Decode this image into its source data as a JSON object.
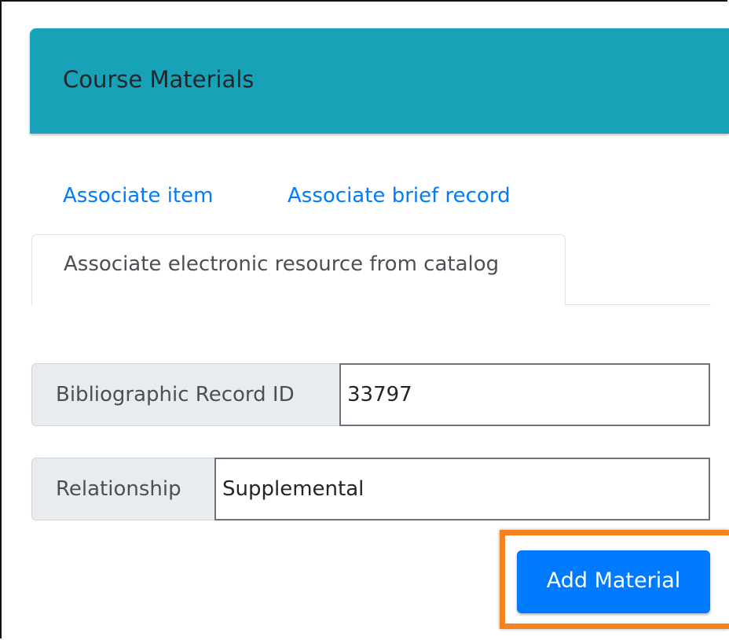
{
  "card": {
    "title": "Course Materials",
    "header_color": "#17a2b8"
  },
  "tabs": [
    {
      "label": "Associate item",
      "active": false
    },
    {
      "label": "Associate brief record",
      "active": false
    },
    {
      "label": "Associate electronic resource from catalog",
      "active": true
    }
  ],
  "form": {
    "bib_id": {
      "label": "Bibliographic Record ID",
      "value": "33797"
    },
    "relationship": {
      "label": "Relationship",
      "value": "Supplemental"
    }
  },
  "actions": {
    "add_label": "Add Material",
    "button_color": "#007bff",
    "highlight_color": "#f5821f"
  }
}
